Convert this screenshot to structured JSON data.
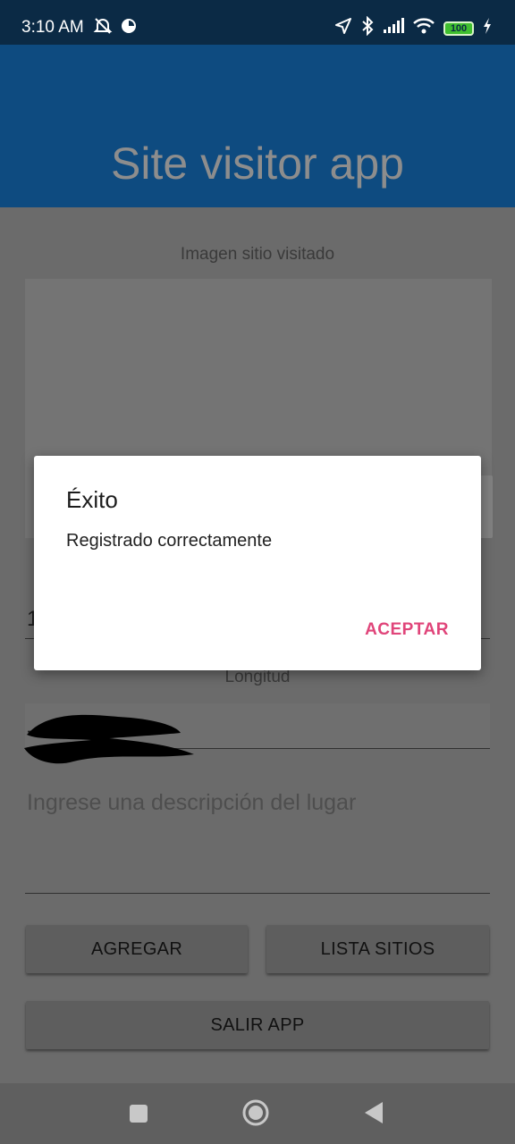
{
  "status_bar": {
    "time": "3:10 AM",
    "battery_level": "100",
    "icons": [
      "muted-alarm-icon",
      "data-saver-icon",
      "location-icon",
      "bluetooth-icon",
      "signal-icon",
      "wifi-icon",
      "battery-icon",
      "charging-icon"
    ]
  },
  "app": {
    "title": "Site visitor app"
  },
  "form": {
    "image_label": "Imagen sitio visitado",
    "latitude_value_visible": "1",
    "longitude_label": "Longitud",
    "longitude_value_visible": "-",
    "description_placeholder": "Ingrese una descripción del lugar",
    "buttons": {
      "add": "AGREGAR",
      "list": "LISTA SITIOS",
      "exit": "SALIR APP"
    }
  },
  "dialog": {
    "title": "Éxito",
    "message": "Registrado correctamente",
    "accept": "ACEPTAR"
  },
  "colors": {
    "status_bar": "#0b2a45",
    "app_bar": "#0e4b80",
    "dialog_accent": "#e0457a"
  }
}
